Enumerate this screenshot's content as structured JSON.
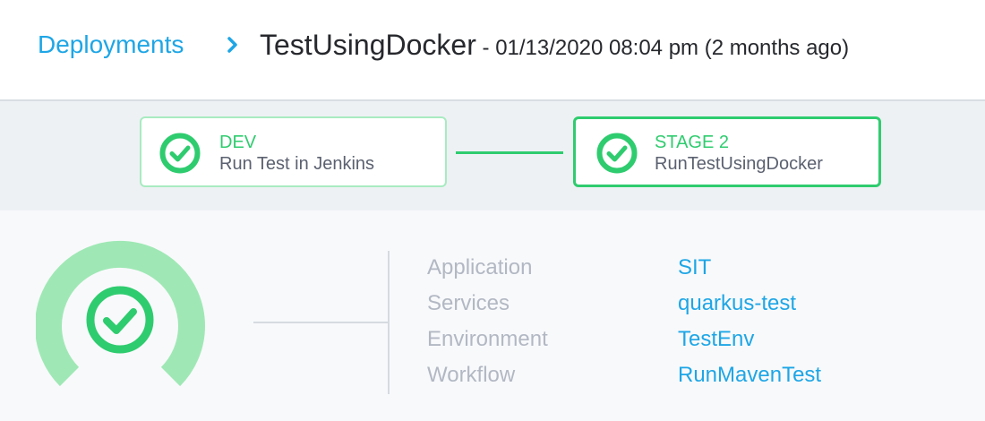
{
  "header": {
    "breadcrumb": "Deployments",
    "title": "TestUsingDocker",
    "subtitle": " - 01/13/2020 08:04 pm (2 months ago)"
  },
  "stages": [
    {
      "name": "DEV",
      "description": "Run Test in Jenkins"
    },
    {
      "name": "STAGE 2",
      "description": "RunTestUsingDocker"
    }
  ],
  "details": {
    "rows": [
      {
        "label": "Application",
        "value": "SIT"
      },
      {
        "label": "Services",
        "value": "quarkus-test"
      },
      {
        "label": "Environment",
        "value": "TestEnv"
      },
      {
        "label": "Workflow",
        "value": "RunMavenTest"
      }
    ]
  },
  "icons": {
    "breadcrumb_separator": "chevron-right-icon",
    "stage_status": "check-circle-icon",
    "overall_status": "success-gauge-icon"
  },
  "colors": {
    "link": "#1ea6e6",
    "success": "#2fcc6f",
    "success_light": "#9fe8b5",
    "label": "#b2b8c3",
    "text": "#26282d"
  }
}
